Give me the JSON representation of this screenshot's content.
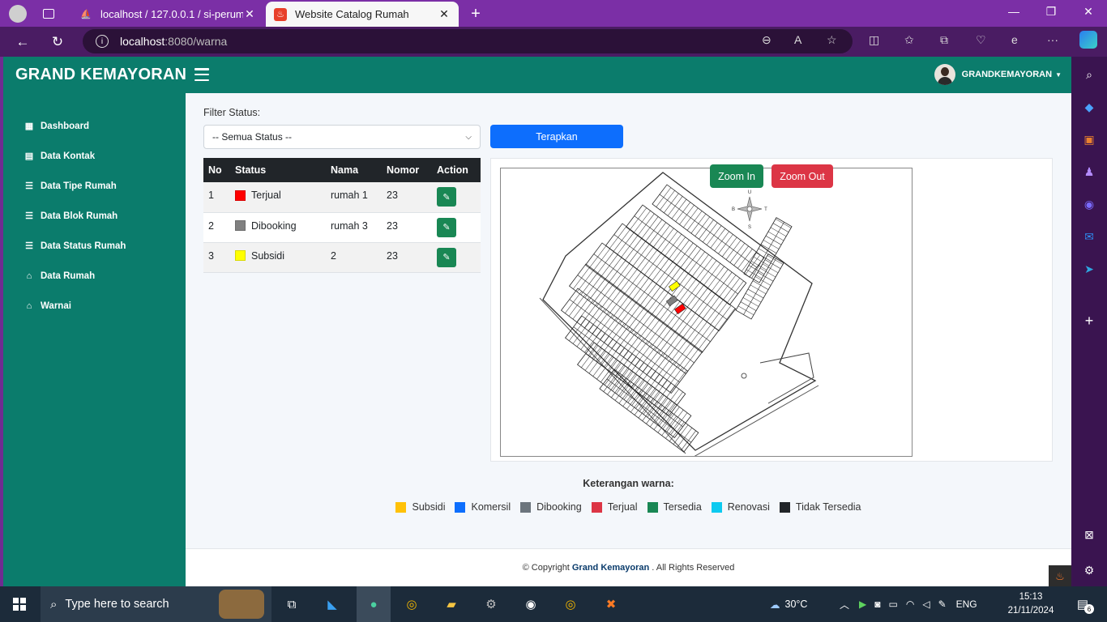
{
  "browser": {
    "tabs": [
      {
        "title": "localhost / 127.0.0.1 / si-perumahan",
        "active": false
      },
      {
        "title": "Website Catalog Rumah",
        "active": true
      }
    ],
    "url_host": "localhost",
    "url_path": ":8080/warna"
  },
  "app": {
    "brand": "GRAND KEMAYORAN",
    "user_name": "GRANDKEMAYORAN",
    "sidebar": [
      {
        "label": "Dashboard",
        "icon": "grid-icon"
      },
      {
        "label": "Data Kontak",
        "icon": "card-icon"
      },
      {
        "label": "Data Tipe Rumah",
        "icon": "list-icon"
      },
      {
        "label": "Data Blok Rumah",
        "icon": "list-icon"
      },
      {
        "label": "Data Status Rumah",
        "icon": "list-icon"
      },
      {
        "label": "Data Rumah",
        "icon": "home-icon"
      },
      {
        "label": "Warnai",
        "icon": "home-icon"
      }
    ]
  },
  "filter": {
    "label": "Filter Status:",
    "selected": "-- Semua Status --",
    "apply_label": "Terapkan"
  },
  "table": {
    "headers": [
      "No",
      "Status",
      "Nama",
      "Nomor",
      "Action"
    ],
    "rows": [
      {
        "no": "1",
        "status": "Terjual",
        "color": "#ff0000",
        "nama": "rumah 1",
        "nomor": "23"
      },
      {
        "no": "2",
        "status": "Dibooking",
        "color": "#808080",
        "nama": "rumah 3",
        "nomor": "23"
      },
      {
        "no": "3",
        "status": "Subsidi",
        "color": "#ffff00",
        "nama": "2",
        "nomor": "23"
      }
    ]
  },
  "map": {
    "zoom_in": "Zoom In",
    "zoom_out": "Zoom Out",
    "compass": {
      "n": "U",
      "s": "S",
      "w": "B",
      "e": "T"
    }
  },
  "legend": {
    "title": "Keterangan warna:",
    "items": [
      {
        "label": "Subsidi",
        "color": "#ffc107"
      },
      {
        "label": "Komersil",
        "color": "#0d6efd"
      },
      {
        "label": "Dibooking",
        "color": "#6c757d"
      },
      {
        "label": "Terjual",
        "color": "#dc3545"
      },
      {
        "label": "Tersedia",
        "color": "#198754"
      },
      {
        "label": "Renovasi",
        "color": "#0dcaf0"
      },
      {
        "label": "Tidak Tersedia",
        "color": "#212529"
      }
    ]
  },
  "footer": {
    "prefix": "© Copyright",
    "brand": "Grand Kemayoran",
    "suffix": ". All Rights Reserved"
  },
  "taskbar": {
    "search_placeholder": "Type here to search",
    "weather": "30°C",
    "lang": "ENG",
    "time": "15:13",
    "date": "21/11/2024",
    "notification_count": "6"
  }
}
